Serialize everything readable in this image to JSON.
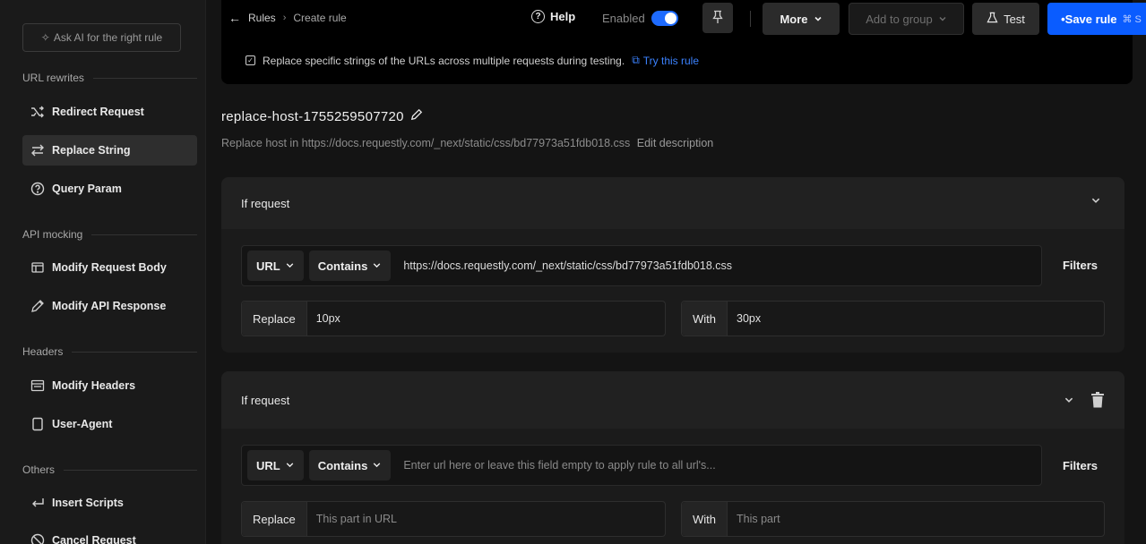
{
  "sidebar": {
    "ask_ai": "Ask AI for the right rule",
    "sections": {
      "url_rewrites": "URL rewrites",
      "api_mocking": "API mocking",
      "headers": "Headers",
      "others": "Others"
    },
    "items": [
      {
        "label": "Redirect Request",
        "icon": "redirect-icon"
      },
      {
        "label": "Replace String",
        "icon": "replace-icon",
        "active": true
      },
      {
        "label": "Query Param",
        "icon": "question-circle-icon"
      },
      {
        "label": "Modify Request Body",
        "icon": "request-body-icon"
      },
      {
        "label": "Modify API Response",
        "icon": "pencil-icon"
      },
      {
        "label": "Modify Headers",
        "icon": "headers-icon"
      },
      {
        "label": "User-Agent",
        "icon": "device-icon"
      },
      {
        "label": "Insert Scripts",
        "icon": "return-arrow-icon"
      },
      {
        "label": "Cancel Request",
        "icon": "cancel-icon"
      }
    ]
  },
  "topbar": {
    "breadcrumb": {
      "root": "Rules",
      "separator": "›",
      "current": "Create rule"
    },
    "help": "Help",
    "enabled_label": "Enabled",
    "enabled": true,
    "more": "More",
    "add_to_group": "Add to group",
    "test": "Test",
    "save": "•Save rule",
    "save_shortcut": "⌘ S",
    "description": "Replace specific strings of the URLs across multiple requests during testing.",
    "try_link": "Try this rule"
  },
  "rule": {
    "name": "replace-host-1755259507720",
    "description": "Replace host in https://docs.requestly.com/_next/static/css/bd77973a51fdb018.css",
    "edit_description": "Edit description"
  },
  "conditions": [
    {
      "header": "If request",
      "url_type": "URL",
      "operator": "Contains",
      "url_value": "https://docs.requestly.com/_next/static/css/bd77973a51fdb018.css",
      "url_placeholder": "",
      "filters": "Filters",
      "replace_label": "Replace",
      "replace_value": "10px",
      "with_label": "With",
      "with_value": "30px"
    },
    {
      "header": "If request",
      "url_type": "URL",
      "operator": "Contains",
      "url_value": "",
      "url_placeholder": "Enter url here or leave this field empty to apply rule to all url's...",
      "filters": "Filters",
      "replace_label": "Replace",
      "replace_placeholder": "This part in URL",
      "with_label": "With",
      "with_placeholder": "This part"
    }
  ],
  "colors": {
    "accent": "#0a5cff",
    "link": "#3b82ff",
    "background": "#141414"
  }
}
